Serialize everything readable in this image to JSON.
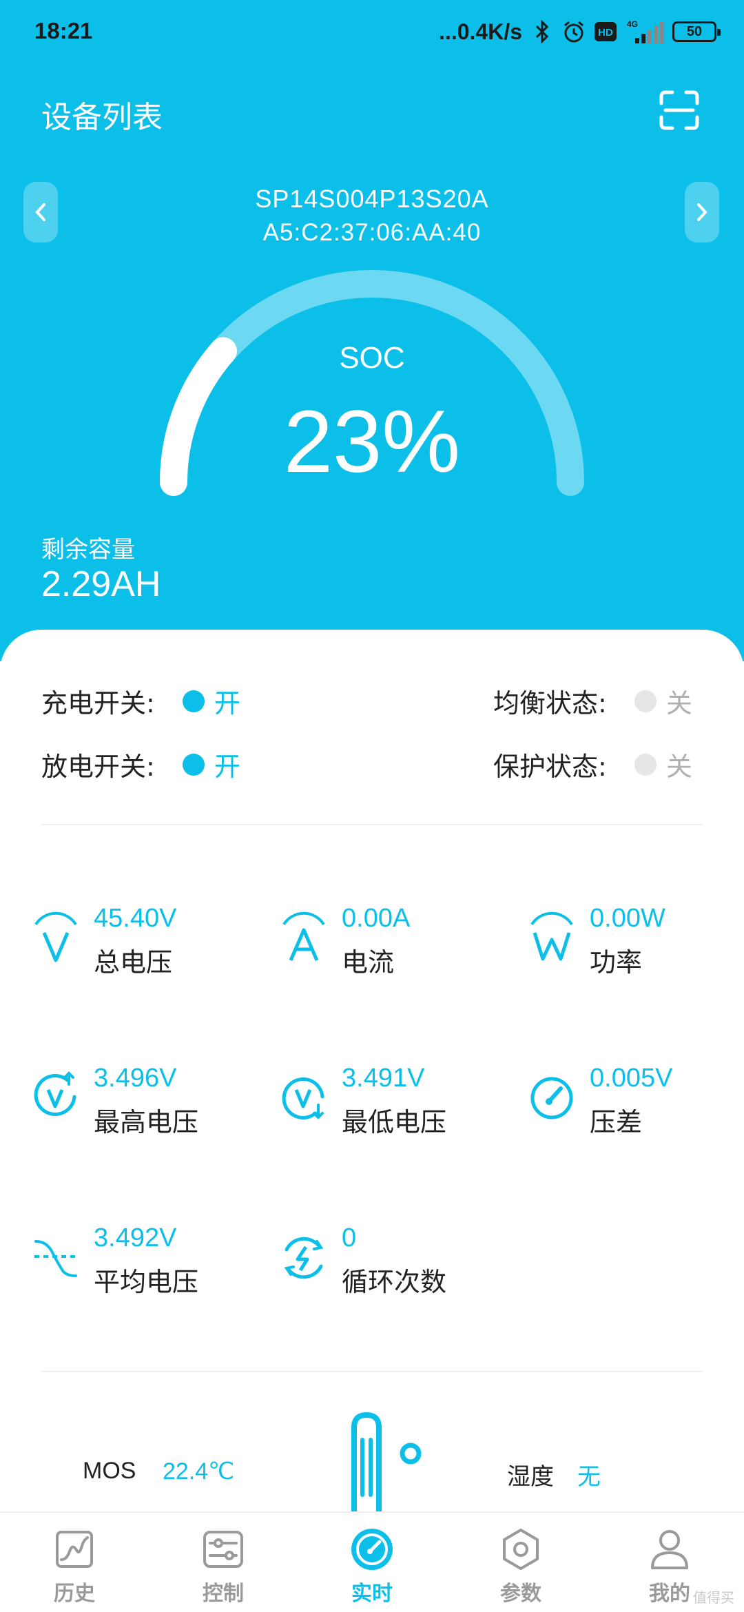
{
  "status_bar": {
    "time": "18:21",
    "network_speed": "...0.4K/s",
    "hd": "HD",
    "signal_type": "4G",
    "battery": "50"
  },
  "header": {
    "title": "设备列表"
  },
  "device": {
    "name": "SP14S004P13S20A",
    "mac": "A5:C2:37:06:AA:40"
  },
  "soc": {
    "label": "SOC",
    "value": "23%",
    "fraction": 0.23
  },
  "remaining": {
    "label": "剩余容量",
    "value": "2.29AH"
  },
  "switches": {
    "charge": {
      "label": "充电开关:",
      "state": "开"
    },
    "discharge": {
      "label": "放电开关:",
      "state": "开"
    },
    "balance": {
      "label": "均衡状态:",
      "state": "关"
    },
    "protect": {
      "label": "保护状态:",
      "state": "关"
    }
  },
  "metrics": {
    "total_voltage": {
      "value": "45.40V",
      "label": "总电压"
    },
    "current": {
      "value": "0.00A",
      "label": "电流"
    },
    "power": {
      "value": "0.00W",
      "label": "功率"
    },
    "max_voltage": {
      "value": "3.496V",
      "label": "最高电压"
    },
    "min_voltage": {
      "value": "3.491V",
      "label": "最低电压"
    },
    "diff_voltage": {
      "value": "0.005V",
      "label": "压差"
    },
    "avg_voltage": {
      "value": "3.492V",
      "label": "平均电压"
    },
    "cycles": {
      "value": "0",
      "label": "循环次数"
    }
  },
  "temperature": {
    "mos_label": "MOS",
    "mos_value": "22.4℃",
    "humidity_label": "湿度",
    "humidity_value": "无"
  },
  "tabs": [
    {
      "label": "历史"
    },
    {
      "label": "控制"
    },
    {
      "label": "实时"
    },
    {
      "label": "参数"
    },
    {
      "label": "我的"
    }
  ],
  "watermark": "值得买",
  "colors": {
    "accent": "#0bbfe9",
    "inactive": "#9a9a9a"
  }
}
